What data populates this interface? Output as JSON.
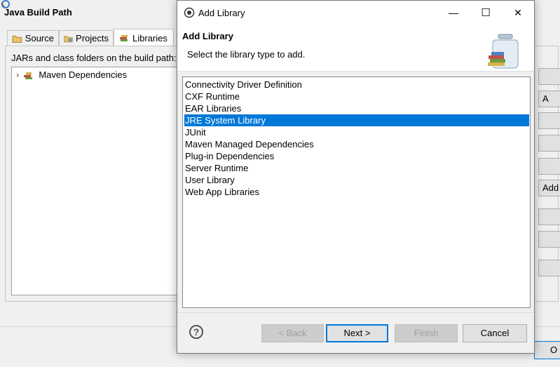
{
  "background_window": {
    "title": "Java Build Path",
    "tabs": [
      {
        "label": "Source",
        "icon": "source-folder-icon"
      },
      {
        "label": "Projects",
        "icon": "projects-icon"
      },
      {
        "label": "Libraries",
        "icon": "libraries-icon",
        "active": true
      }
    ],
    "description": "JARs and class folders on the build path:",
    "tree": [
      {
        "label": "Maven Dependencies",
        "icon": "library-icon",
        "expander": "›"
      }
    ],
    "side_buttons": [
      "",
      "A",
      "",
      "",
      "",
      "Add",
      "",
      "",
      ""
    ],
    "ok_label": "O"
  },
  "dialog": {
    "window_title": "Add Library",
    "window_controls": {
      "minimize": "—",
      "maximize": "☐",
      "close": "✕"
    },
    "header_title": "Add Library",
    "header_message": "Select the library type to add.",
    "library_types": [
      "Connectivity Driver Definition",
      "CXF Runtime",
      "EAR Libraries",
      "JRE System Library",
      "JUnit",
      "Maven Managed Dependencies",
      "Plug-in Dependencies",
      "Server Runtime",
      "User Library",
      "Web App Libraries"
    ],
    "selected_index": 3,
    "help_glyph": "?",
    "buttons": {
      "back": "< Back",
      "next": "Next >",
      "finish": "Finish",
      "cancel": "Cancel"
    }
  },
  "colors": {
    "selection": "#0078d7",
    "default_border": "#0078d7"
  }
}
